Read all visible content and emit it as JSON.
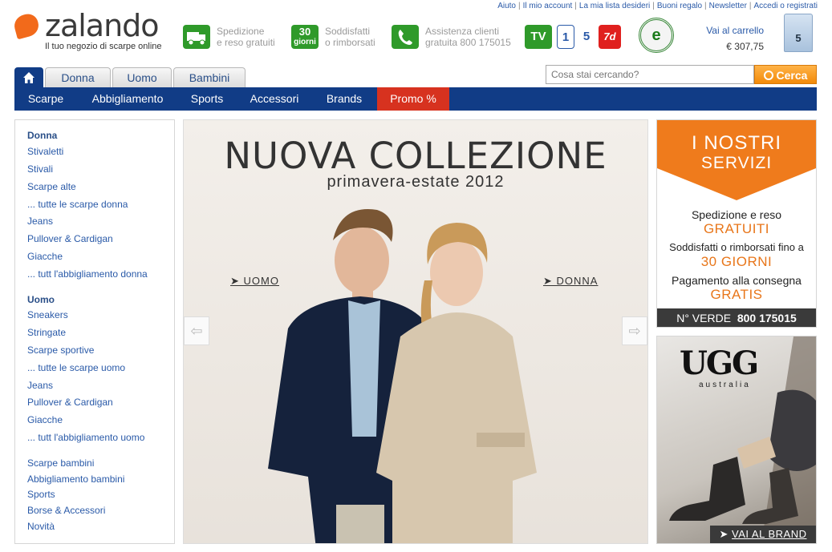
{
  "utility_links": [
    "Aiuto",
    "Il mio account",
    "La mia lista desideri",
    "Buoni regalo",
    "Newsletter",
    "Accedi o registrati"
  ],
  "logo": {
    "name": "zalando",
    "tagline": "Il tuo negozio di scarpe online"
  },
  "services_strip": [
    {
      "icon": "truck-icon",
      "line1": "Spedizione",
      "line2": "e reso gratuiti"
    },
    {
      "icon": "30-giorni-icon",
      "badge": "30 giorni",
      "line1": "Soddisfatti",
      "line2": "o rimborsati"
    },
    {
      "icon": "phone-icon",
      "line1": "Assistenza clienti",
      "line2": "gratuita 800 175015"
    }
  ],
  "tv_logos": [
    "TV",
    "Rai 1",
    "5",
    "7d"
  ],
  "cart": {
    "label": "Vai al carrello",
    "total": "€ 307,75",
    "count": "5"
  },
  "tabs": [
    "Donna",
    "Uomo",
    "Bambini"
  ],
  "search": {
    "placeholder": "Cosa stai cercando?",
    "button": "Cerca"
  },
  "nav": [
    "Scarpe",
    "Abbigliamento",
    "Sports",
    "Accessori",
    "Brands",
    "Promo %"
  ],
  "sidebar": {
    "donna": {
      "title": "Donna",
      "items": [
        "Stivaletti",
        "Stivali",
        "Scarpe alte",
        "... tutte le scarpe donna",
        "Jeans",
        "Pullover & Cardigan",
        "Giacche",
        "... tutt l'abbigliamento donna"
      ]
    },
    "uomo": {
      "title": "Uomo",
      "items": [
        "Sneakers",
        "Stringate",
        "Scarpe sportive",
        "... tutte le scarpe uomo",
        "Jeans",
        "Pullover & Cardigan",
        "Giacche",
        "... tutt l'abbigliamento uomo"
      ]
    },
    "other": [
      "Scarpe bambini",
      "Abbigliamento bambini",
      "Sports",
      "Borse & Accessori",
      "Novità"
    ]
  },
  "banner": {
    "title": "NUOVA COLLEZIONE",
    "subtitle": "primavera-estate 2012",
    "left_link": "UOMO",
    "right_link": "DONNA"
  },
  "servizi": {
    "title_l1": "I NOSTRI",
    "title_l2": "SERVIZI",
    "rows": [
      {
        "label": "Spedizione e reso",
        "highlight": "GRATUITI"
      },
      {
        "label": "Soddisfatti o rimborsati fino a",
        "highlight": "30 GIORNI"
      },
      {
        "label": "Pagamento alla consegna",
        "highlight": "GRATIS"
      }
    ],
    "footer_label": "N° VERDE",
    "footer_number": "800 175015"
  },
  "ugg": {
    "logo": "UGG",
    "sub": "australia",
    "cta": "VAI AL BRAND"
  },
  "colors": {
    "brand_blue": "#113c86",
    "promo_red": "#d7321f",
    "orange": "#f28a0a",
    "link_blue": "#2a5aa8"
  }
}
